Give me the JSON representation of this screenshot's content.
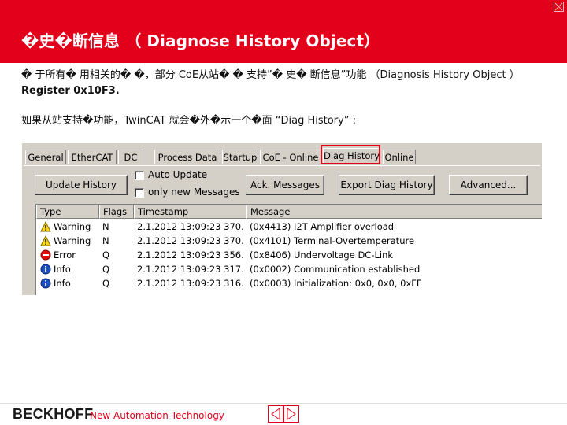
{
  "slide": {
    "title": "�史�断信息 （ Diagnose History Object）",
    "para1_text": "� 于所有� 用相关的� �，部分 CoE从站� � 支持”� 史� 断信息”功能 （Diagnosis History Object ） ",
    "para1_bold": "Register 0x10F3.",
    "para2": "如果从站支持�功能，TwinCAT 就会�外�示一个�面 “Diag History” :"
  },
  "tabs": [
    "General",
    "EtherCAT",
    "DC",
    "Process Data",
    "Startup",
    "CoE - Online",
    "Diag History",
    "Online"
  ],
  "active_tab": "Diag History",
  "buttons": {
    "update_history": "Update History",
    "ack_messages": "Ack. Messages",
    "export_diag": "Export Diag History",
    "advanced": "Advanced..."
  },
  "checkboxes": {
    "auto_update": "Auto Update",
    "only_new": "only new Messages"
  },
  "table": {
    "columns": [
      "Type",
      "Flags",
      "Timestamp",
      "Message"
    ],
    "rows": [
      {
        "icon": "warning-icon",
        "type": "Warning",
        "flags": "N",
        "timestamp": "2.1.2012 13:09:23 370...",
        "message": "(0x4413) I2T Amplifier overload"
      },
      {
        "icon": "warning-icon",
        "type": "Warning",
        "flags": "N",
        "timestamp": "2.1.2012 13:09:23 370...",
        "message": "(0x4101) Terminal-Overtemperature"
      },
      {
        "icon": "error-icon",
        "type": "Error",
        "flags": "Q",
        "timestamp": "2.1.2012 13:09:23 356...",
        "message": "(0x8406) Undervoltage DC-Link"
      },
      {
        "icon": "info-icon",
        "type": "Info",
        "flags": "Q",
        "timestamp": "2.1.2012 13:09:23 317...",
        "message": "(0x0002) Communication established"
      },
      {
        "icon": "info-icon",
        "type": "Info",
        "flags": "Q",
        "timestamp": "2.1.2012 13:09:23 316...",
        "message": "(0x0003) Initialization: 0x0, 0x0, 0xFF"
      }
    ]
  },
  "footer": {
    "brand": "BECKHOFF",
    "tagline": "New Automation Technology"
  },
  "colors": {
    "brand_red": "#e2001a",
    "dialog_gray": "#d4d0c8"
  }
}
